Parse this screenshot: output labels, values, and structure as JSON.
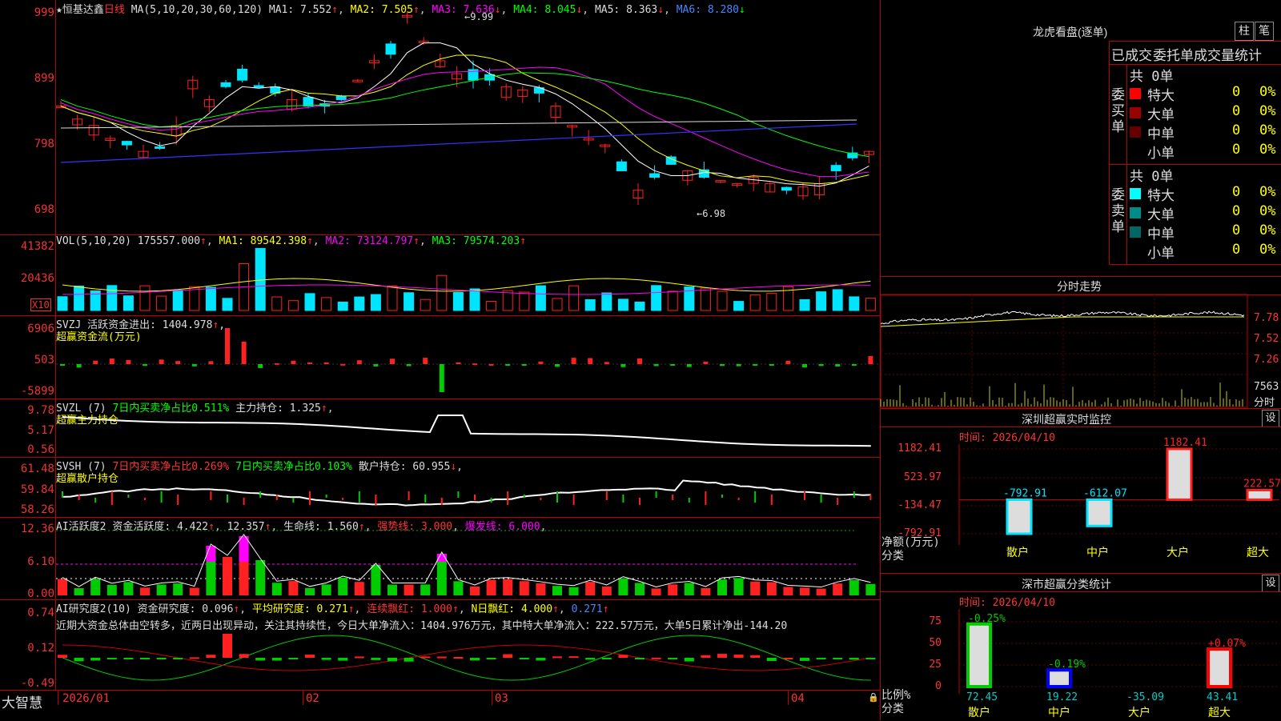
{
  "title": {
    "star": "★",
    "stock": "恒基达鑫",
    "period": "日线"
  },
  "ma": {
    "params": "MA(5,10,20,30,60,120)",
    "ma1": "MA1: 7.552",
    "ma2": "MA2: 7.505",
    "ma3": "MA3: 7.636",
    "ma4": "MA4: 8.045",
    "ma5": "MA5: 8.363",
    "ma6": "MA6: 8.280"
  },
  "price_axis": [
    "999",
    "899",
    "798",
    "698"
  ],
  "price_marks": {
    "high": "9.99",
    "low": "6.98"
  },
  "vol": {
    "params": "VOL(5,10,20)",
    "value": "175557.000",
    "ma1": "MA1: 89542.398",
    "ma2": "MA2: 73124.797",
    "ma3": "MA3: 79574.203",
    "axis": [
      "41382",
      "20436"
    ],
    "unit": "X10"
  },
  "svzj": {
    "line1": "SVZJ  活跃资金进出: 1404.978",
    "line2": "超赢资金流(万元)",
    "axis": [
      "6906",
      "503",
      "-5899"
    ]
  },
  "svzl": {
    "line1a": "SVZL (7)",
    "line1b": "7日内买卖净占比0.511%",
    "line1c": "主力持仓: 1.325",
    "line2": "超赢主力持仓",
    "axis": [
      "9.78",
      "5.17",
      "0.56"
    ]
  },
  "svsh": {
    "line1a": "SVSH (7)",
    "line1b": "7日内买卖净占比0.269%",
    "line1c": "7日内买卖净占比0.103%",
    "line1d": "散户持仓: 60.955",
    "line2": "超赢散户持仓",
    "axis": [
      "61.48",
      "59.84",
      "58.26"
    ]
  },
  "ai1": {
    "a": "AI活跃度2",
    "b": "资金活跃度: 4.422",
    "c": "12.357",
    "d": "生命线: 1.560",
    "e": "强势线: 3.000",
    "f": "爆发线: 6.000",
    "axis": [
      "12.36",
      "6.10",
      "0.00"
    ]
  },
  "ai2": {
    "a": "AI研究度2(10)",
    "b": "资金研究度: 0.096",
    "c": "平均研究度: 0.271",
    "d": "连续飘红: 1.000",
    "e": "N日飘红: 4.000",
    "f": "0.271",
    "axis": [
      "0.74",
      "0.12",
      "-0.49"
    ],
    "comment": "近期大资金总体由空转多，近两日出现异动，关注其持续性，今日大单净流入：1404.976万元，其中特大单净流入：222.57万元，大单5日累计净出-144.20"
  },
  "xaxis": {
    "brand": "大智慧",
    "labels": [
      "2026/01",
      "02",
      "03",
      "04"
    ]
  },
  "lhb": {
    "title": "龙虎看盘(逐单)",
    "btn1": "柱",
    "btn2": "笔",
    "tabs": [
      "已成交",
      "委托单",
      "成交量统计"
    ],
    "buy": {
      "side": "委买单",
      "total": "共 0单",
      "rows": [
        {
          "name": "特大",
          "v": "0",
          "p": "0%",
          "color": "#ff0000"
        },
        {
          "name": "大单",
          "v": "0",
          "p": "0%",
          "color": "#990000"
        },
        {
          "name": "中单",
          "v": "0",
          "p": "0%",
          "color": "#660000"
        },
        {
          "name": "小单",
          "v": "0",
          "p": "0%",
          "color": "#000000"
        }
      ]
    },
    "sell": {
      "side": "委卖单",
      "total": "共 0单",
      "rows": [
        {
          "name": "特大",
          "v": "0",
          "p": "0%",
          "color": "#00ffff"
        },
        {
          "name": "大单",
          "v": "0",
          "p": "0%",
          "color": "#008b8b"
        },
        {
          "name": "中单",
          "v": "0",
          "p": "0%",
          "color": "#006666"
        },
        {
          "name": "小单",
          "v": "0",
          "p": "0%",
          "color": "#000000"
        }
      ]
    }
  },
  "fenshi": {
    "title": "分时走势",
    "axis": [
      "7.78",
      "7.52",
      "7.26"
    ],
    "vol_label": "7563",
    "vol_unit": "分时"
  },
  "sz_monitor": {
    "title": "深圳超赢实时监控",
    "btn": "设",
    "time": "时间: 2026/04/10",
    "axis": [
      "1182.41",
      "523.97",
      "-134.47",
      "-792.91"
    ],
    "ylabel": "净额(万元)",
    "xlabel": "分类",
    "categories": [
      "散户",
      "中户",
      "大户",
      "超大"
    ],
    "values": [
      -792.91,
      -612.07,
      1182.41,
      222.57
    ],
    "value_labels": [
      "-792.91",
      "-612.07",
      "1182.41",
      "222.57"
    ]
  },
  "sz_class": {
    "title": "深市超赢分类统计",
    "btn": "设",
    "time": "时间: 2026/04/10",
    "axis": [
      "75",
      "50",
      "25",
      "0"
    ],
    "ylabel": "比例%",
    "xlabel": "分类",
    "categories": [
      "散户",
      "中户",
      "大户",
      "超大"
    ],
    "bars": [
      72.45,
      19.22,
      0,
      43.41
    ],
    "top_labels": [
      "-0.25%",
      "-0.19%",
      "",
      "+0.07%"
    ],
    "bottom_labels": [
      "72.45",
      "19.22",
      "-35.09",
      "43.41"
    ]
  },
  "colors": {
    "up": "#ff2020",
    "down": "#00e5ff",
    "grid": "#b00000"
  }
}
